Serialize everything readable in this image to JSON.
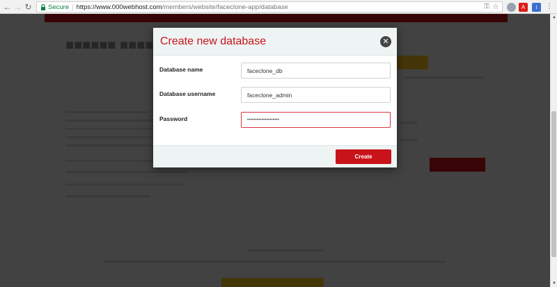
{
  "browser": {
    "secure_label": "Secure",
    "url_host": "https://www.000webhost.com",
    "url_path": "/members/website/faceclone-app/database"
  },
  "modal": {
    "title": "Create new database",
    "fields": [
      {
        "label": "Database name",
        "value": "faceclone_db"
      },
      {
        "label": "Database username",
        "value": "faceclone_admin"
      },
      {
        "label": "Password",
        "value": "••••••••••••••••••••"
      }
    ],
    "create_label": "Create"
  },
  "colors": {
    "brand_red": "#c8131a",
    "secure_green": "#0b8043",
    "accent_yellow": "#f3c221"
  }
}
